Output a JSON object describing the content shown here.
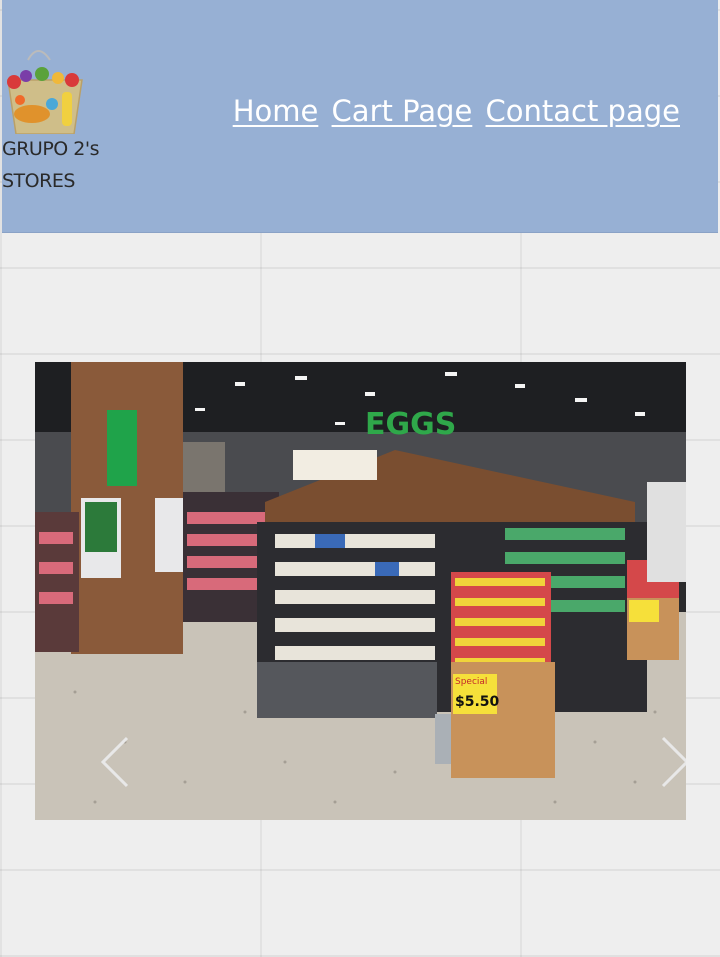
{
  "logo": {
    "line1": "GRUPO 2's",
    "line2": "STORES"
  },
  "nav": {
    "items": [
      {
        "label": "Home"
      },
      {
        "label": "Cart Page"
      },
      {
        "label": "Contact page"
      }
    ]
  },
  "carousel": {
    "sign_text": "EGGS",
    "price_tag": "$5.50",
    "special_tag": "Special",
    "prev_icon": "chevron-left-icon",
    "next_icon": "chevron-right-icon"
  },
  "colors": {
    "header_bg": "#97b0d4",
    "nav_text": "#ffffff"
  }
}
